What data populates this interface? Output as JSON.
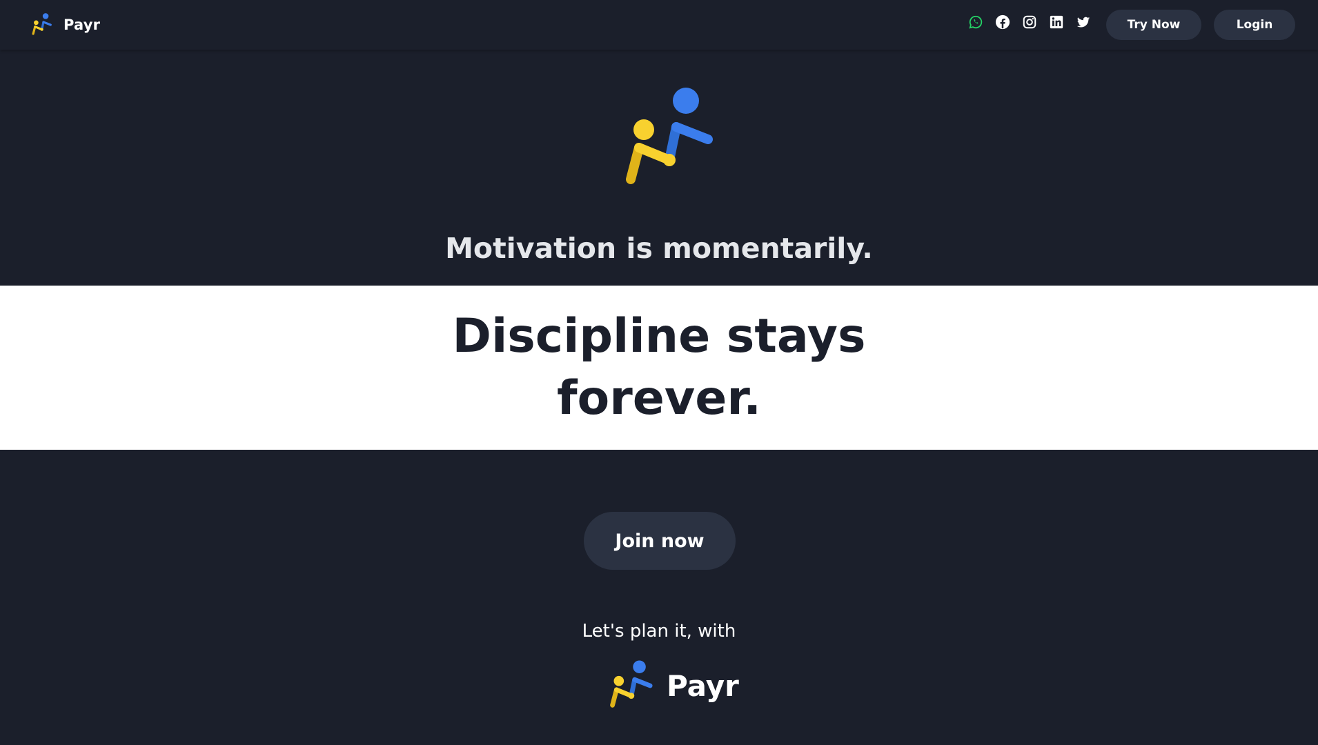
{
  "nav": {
    "brand": "Payr",
    "socials": [
      {
        "icon": "whatsapp-icon",
        "color": "#25d366"
      },
      {
        "icon": "facebook-icon",
        "color": "#ffffff"
      },
      {
        "icon": "instagram-icon",
        "color": "#ffffff"
      },
      {
        "icon": "linkedin-icon",
        "color": "#ffffff"
      },
      {
        "icon": "twitter-icon",
        "color": "#ffffff"
      }
    ],
    "try_now_label": "Try Now",
    "login_label": "Login"
  },
  "hero": {
    "motivation": "Motivation is momentarily.",
    "discipline": "Discipline stays forever.",
    "join_label": "Join now",
    "plan_text": "Let's plan it, with",
    "brand": "Payr"
  },
  "colors": {
    "background": "#1b1f2b",
    "band": "#ffffff",
    "button": "#2b3242",
    "logo_blue": "#3b7ded",
    "logo_yellow": "#f8d12f"
  }
}
